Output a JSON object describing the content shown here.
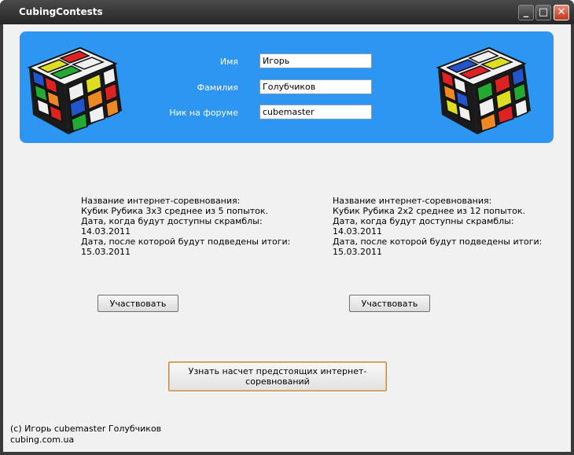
{
  "window": {
    "title": "CubingContests"
  },
  "form": {
    "name_label": "Имя",
    "name_value": "Игорь",
    "surname_label": "Фамилия",
    "surname_value": "Голубчиков",
    "nick_label": "Ник на форуме",
    "nick_value": "cubemaster"
  },
  "contests": [
    {
      "name_label": "Название интернет-соревнования:",
      "name": "Кубик Рубика 3x3 среднее из 5 попыток.",
      "scramble_label": "Дата, когда будут доступны скрамблы:",
      "scramble_date": "14.03.2011",
      "results_label": "Дата, после которой будут подведены итоги:",
      "results_date": "15.03.2011",
      "button": "Участвовать"
    },
    {
      "name_label": "Название интернет-соревнования:",
      "name": "Кубик Рубика 2x2 среднее из 12 попыток.",
      "scramble_label": "Дата, когда будут доступны скрамблы:",
      "scramble_date": "14.03.2011",
      "results_label": "Дата, после которой будут подведены итоги:",
      "results_date": "15.03.2011",
      "button": "Участвовать"
    }
  ],
  "upcoming_button": "Узнать насчет предстоящих интернет-соревнований",
  "footer": {
    "copyright": "(c) Игорь cubemaster Голубчиков",
    "site": "cubing.com.ua"
  },
  "colors": {
    "banner": "#2d96f2",
    "titlebar": "#262626"
  },
  "icons": [
    "minimize-icon",
    "maximize-icon",
    "close-icon",
    "rubik-cube-left",
    "rubik-cube-right"
  ]
}
